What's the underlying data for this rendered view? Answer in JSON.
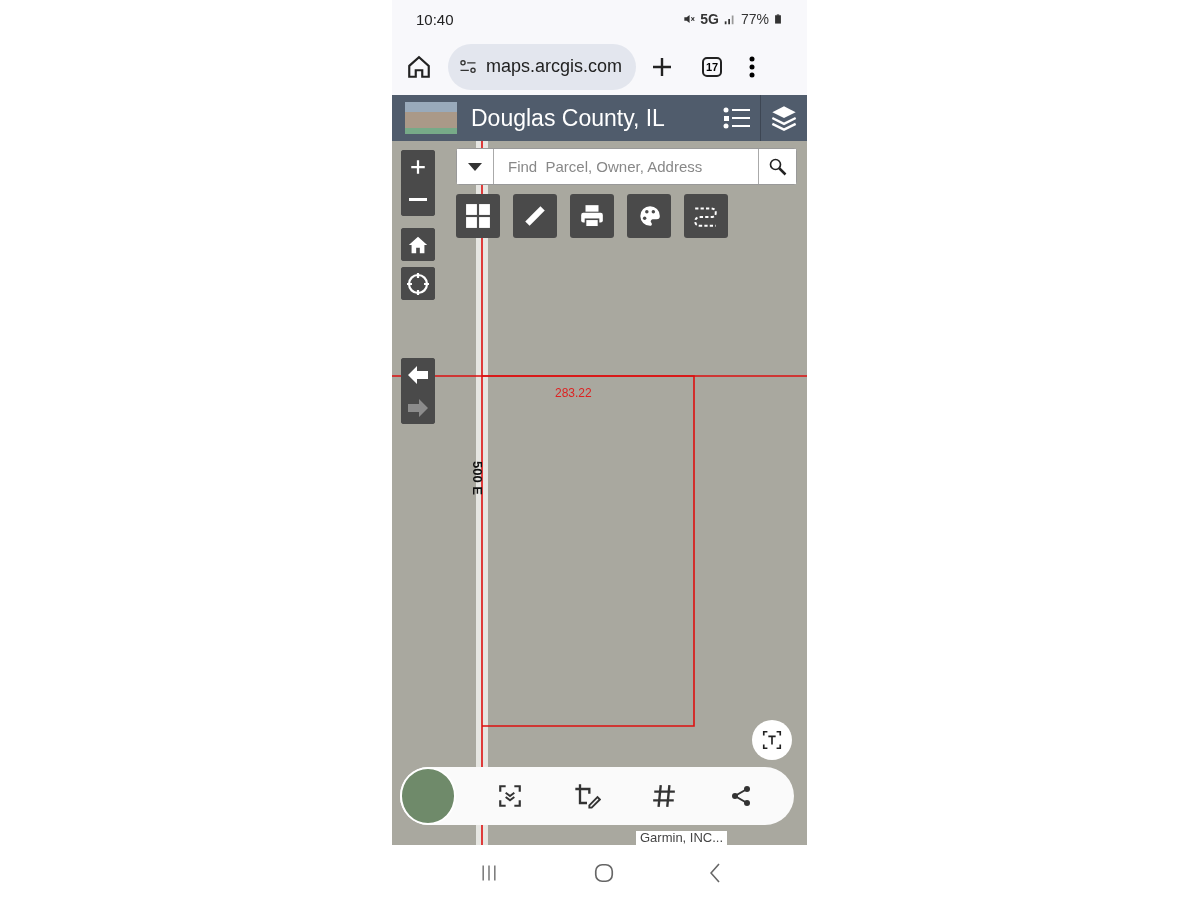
{
  "status_bar": {
    "time": "10:40",
    "network": "5G",
    "battery": "77%"
  },
  "browser": {
    "url": "maps.arcgis.com",
    "tab_count": "17"
  },
  "app_header": {
    "title": "Douglas County, IL"
  },
  "search": {
    "placeholder": "Find  Parcel, Owner, Address"
  },
  "nav_arrows": [
    {
      "kind": "back",
      "disabled": false
    },
    {
      "kind": "forward",
      "disabled": true
    }
  ],
  "map": {
    "labels": [
      {
        "text": "283.22",
        "kind": "dimension"
      },
      {
        "text": "500 E",
        "kind": "road"
      }
    ],
    "attribution": "Garmin, INC..."
  }
}
